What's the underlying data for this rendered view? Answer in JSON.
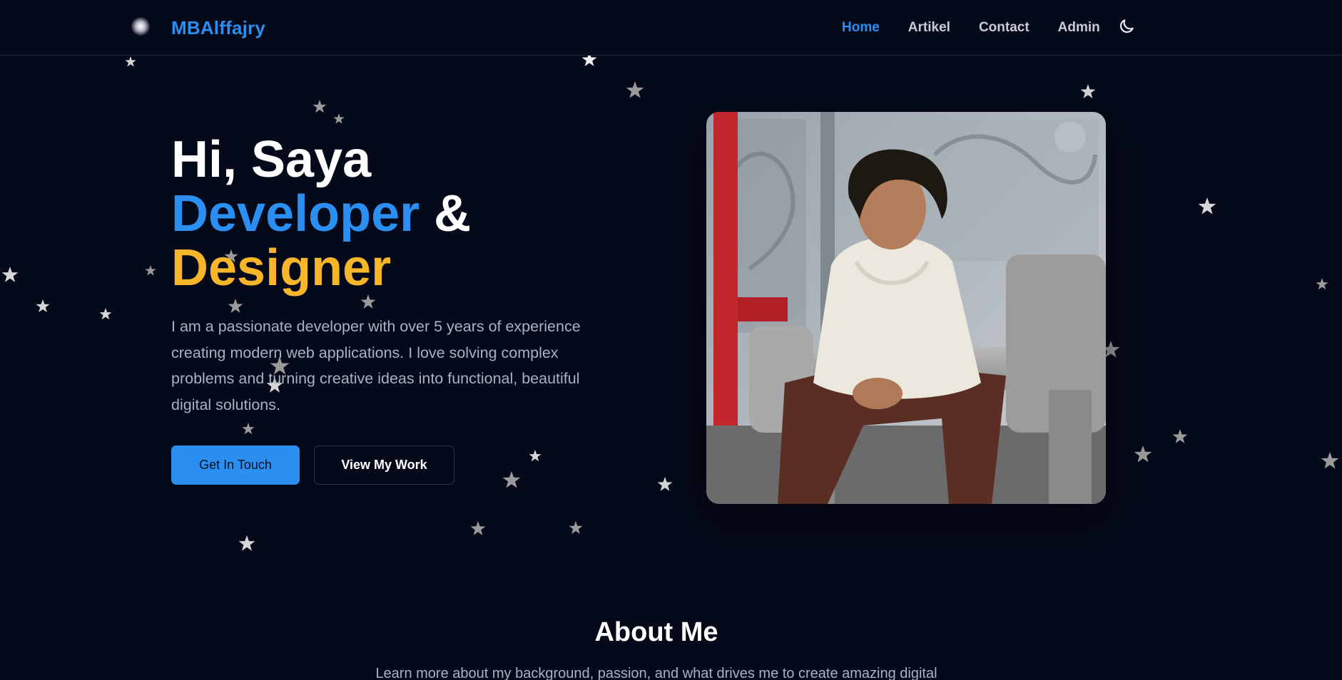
{
  "header": {
    "brand": "MBAlffajry",
    "nav": [
      {
        "label": "Home",
        "active": true
      },
      {
        "label": "Artikel",
        "active": false
      },
      {
        "label": "Contact",
        "active": false
      },
      {
        "label": "Admin",
        "active": false
      }
    ],
    "theme_toggle_icon": "moon-icon"
  },
  "hero": {
    "greeting": "Hi, Saya",
    "role_1": "Developer",
    "ampersand": "&",
    "role_2": "Designer",
    "description": "I am a passionate developer with over 5 years of experience creating modern web applications. I love solving complex problems and turning creative ideas into functional, beautiful digital solutions.",
    "primary_button": "Get In Touch",
    "secondary_button": "View My Work"
  },
  "about": {
    "title": "About Me",
    "subtitle": "Learn more about my background, passion, and what drives me to create amazing digital"
  },
  "colors": {
    "background": "#050a1a",
    "accent_blue": "#2a8ff0",
    "accent_yellow": "#f7b52a",
    "text_muted": "#aab1c0"
  }
}
